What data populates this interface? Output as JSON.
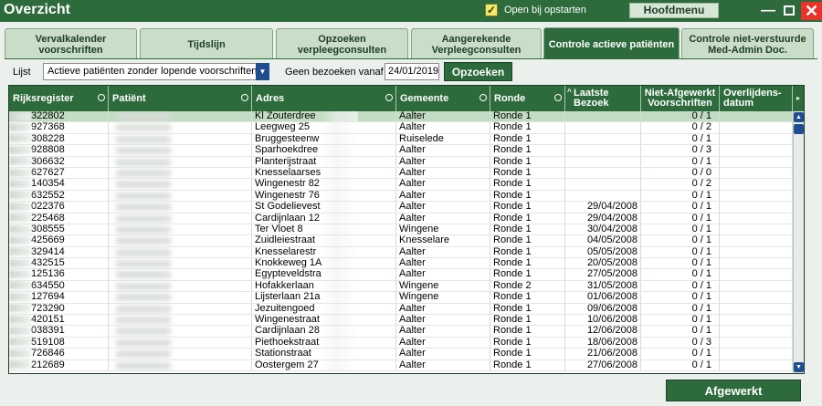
{
  "window": {
    "title": "Overzicht",
    "checkbox_label": "Open bij opstarten",
    "checkbox_checked": true,
    "menu_button": "Hoofdmenu"
  },
  "tabs": [
    {
      "label": "Vervalkalender voorschriften",
      "active": false
    },
    {
      "label": "Tijdslijn",
      "active": false
    },
    {
      "label": "Opzoeken verpleegconsulten",
      "active": false
    },
    {
      "label": "Aangerekende Verpleegconsulten",
      "active": false
    },
    {
      "label": "Controle actieve patiënten",
      "active": true
    },
    {
      "label": "Controle niet-verstuurde Med-Admin Doc.",
      "active": false
    }
  ],
  "filters": {
    "list_label": "Lijst",
    "list_value": "Actieve patiënten zonder lopende voorschriften",
    "visits_label": "Geen bezoeken vanaf",
    "date_value": "24/01/2019",
    "search_button": "Opzoeken"
  },
  "table": {
    "headers": {
      "rijksregister": "Rijksregister",
      "patient": "Patiënt",
      "adres": "Adres",
      "gemeente": "Gemeente",
      "ronde": "Ronde",
      "laatste": "Laatste Bezoek",
      "niet_afgewerkt": "Niet-Afgewerkt Voorschriften",
      "overlijden": "Overlijdens-datum"
    },
    "rows": [
      {
        "rr": "322802",
        "adres": "Kl Zouterdree",
        "gemeente": "Aalter",
        "ronde": "Ronde 1",
        "laatste": "",
        "na": "0 / 1",
        "ov": ""
      },
      {
        "rr": "927368",
        "adres": "Leegweg 25",
        "gemeente": "Aalter",
        "ronde": "Ronde 1",
        "laatste": "",
        "na": "0 / 2",
        "ov": ""
      },
      {
        "rr": "308228",
        "adres": "Bruggesteenw",
        "gemeente": "Ruiselede",
        "ronde": "Ronde 1",
        "laatste": "",
        "na": "0 / 1",
        "ov": ""
      },
      {
        "rr": "928808",
        "adres": "Sparhoekdree",
        "gemeente": "Aalter",
        "ronde": "Ronde 1",
        "laatste": "",
        "na": "0 / 3",
        "ov": ""
      },
      {
        "rr": "306632",
        "adres": "Planterijstraat",
        "gemeente": "Aalter",
        "ronde": "Ronde 1",
        "laatste": "",
        "na": "0 / 1",
        "ov": ""
      },
      {
        "rr": "627627",
        "adres": "Knesselaarses",
        "gemeente": "Aalter",
        "ronde": "Ronde 1",
        "laatste": "",
        "na": "0 / 0",
        "ov": ""
      },
      {
        "rr": "140354",
        "adres": "Wingenestr 82",
        "gemeente": "Aalter",
        "ronde": "Ronde 1",
        "laatste": "",
        "na": "0 / 2",
        "ov": ""
      },
      {
        "rr": "632552",
        "adres": "Wingenestr 76",
        "gemeente": "Aalter",
        "ronde": "Ronde 1",
        "laatste": "",
        "na": "0 / 1",
        "ov": ""
      },
      {
        "rr": "022376",
        "adres": "St Godelievest",
        "gemeente": "Aalter",
        "ronde": "Ronde 1",
        "laatste": "29/04/2008",
        "na": "0 / 1",
        "ov": ""
      },
      {
        "rr": "225468",
        "adres": "Cardijnlaan 12",
        "gemeente": "Aalter",
        "ronde": "Ronde 1",
        "laatste": "29/04/2008",
        "na": "0 / 1",
        "ov": ""
      },
      {
        "rr": "308555",
        "adres": "Ter Vloet 8",
        "gemeente": "Wingene",
        "ronde": "Ronde 1",
        "laatste": "30/04/2008",
        "na": "0 / 1",
        "ov": ""
      },
      {
        "rr": "425669",
        "adres": "Zuidleiestraat",
        "gemeente": "Knesselare",
        "ronde": "Ronde 1",
        "laatste": "04/05/2008",
        "na": "0 / 1",
        "ov": ""
      },
      {
        "rr": "329414",
        "adres": "Knesselarestr",
        "gemeente": "Aalter",
        "ronde": "Ronde 1",
        "laatste": "05/05/2008",
        "na": "0 / 1",
        "ov": ""
      },
      {
        "rr": "432515",
        "adres": "Knokkeweg 1A",
        "gemeente": "Aalter",
        "ronde": "Ronde 1",
        "laatste": "20/05/2008",
        "na": "0 / 1",
        "ov": ""
      },
      {
        "rr": "125136",
        "adres": "Egypteveldstra",
        "gemeente": "Aalter",
        "ronde": "Ronde 1",
        "laatste": "27/05/2008",
        "na": "0 / 1",
        "ov": ""
      },
      {
        "rr": "634550",
        "adres": "Hofakkerlaan",
        "gemeente": "Wingene",
        "ronde": "Ronde 2",
        "laatste": "31/05/2008",
        "na": "0 / 1",
        "ov": ""
      },
      {
        "rr": "127694",
        "adres": "Lijsterlaan 21a",
        "gemeente": "Wingene",
        "ronde": "Ronde 1",
        "laatste": "01/06/2008",
        "na": "0 / 1",
        "ov": ""
      },
      {
        "rr": "723290",
        "adres": "Jezuitengoed",
        "gemeente": "Aalter",
        "ronde": "Ronde 1",
        "laatste": "09/06/2008",
        "na": "0 / 1",
        "ov": ""
      },
      {
        "rr": "420151",
        "adres": "Wingenestraat",
        "gemeente": "Aalter",
        "ronde": "Ronde 1",
        "laatste": "10/06/2008",
        "na": "0 / 1",
        "ov": ""
      },
      {
        "rr": "038391",
        "adres": "Cardijnlaan 28",
        "gemeente": "Aalter",
        "ronde": "Ronde 1",
        "laatste": "12/06/2008",
        "na": "0 / 1",
        "ov": ""
      },
      {
        "rr": "519108",
        "adres": "Piethoekstraat",
        "gemeente": "Aalter",
        "ronde": "Ronde 1",
        "laatste": "18/06/2008",
        "na": "0 / 3",
        "ov": ""
      },
      {
        "rr": "726846",
        "adres": "Stationstraat",
        "gemeente": "Aalter",
        "ronde": "Ronde 1",
        "laatste": "21/06/2008",
        "na": "0 / 1",
        "ov": ""
      },
      {
        "rr": "212689",
        "adres": "Oostergem 27",
        "gemeente": "Aalter",
        "ronde": "Ronde 1",
        "laatste": "27/06/2008",
        "na": "0 / 1",
        "ov": ""
      }
    ]
  },
  "footer": {
    "done_button": "Afgewerkt"
  },
  "colors": {
    "accent": "#2d6a3c",
    "tab_inactive": "#c9ddc9",
    "selection": "#c3dcc4",
    "scrollbar": "#1f4d92",
    "close": "#e8332a"
  }
}
